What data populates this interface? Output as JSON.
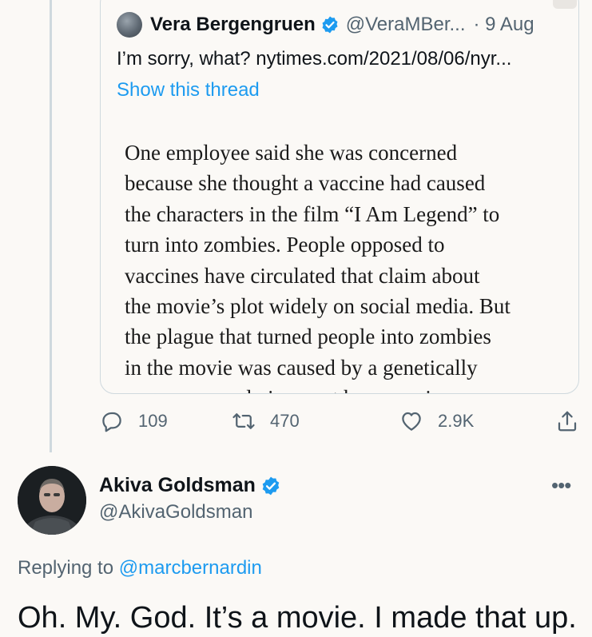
{
  "quoted_tweet": {
    "author_name": "Vera Bergengruen",
    "author_handle": "@VeraMBer...",
    "date": "· 9 Aug",
    "text": "I’m sorry, what? nytimes.com/2021/08/06/nyr...",
    "show_thread": "Show this thread",
    "article_lines": [
      "One employee said she was concerned",
      "because she thought a vaccine had caused",
      "the characters in the film “I Am Legend” to",
      "turn into zombies. People opposed to",
      "vaccines have circulated that claim about",
      "the movie’s plot widely on social media. But",
      "the plague that turned people into zombies",
      "in the movie was caused by a genetically",
      "reprogrammed virus, not by a vaccine."
    ]
  },
  "actions": {
    "reply_count": "109",
    "retweet_count": "470",
    "like_count": "2.9K"
  },
  "reply_tweet": {
    "author_name": "Akiva Goldsman",
    "author_handle": "@AkivaGoldsman",
    "replying_prefix": "Replying to",
    "replying_to": "@marcbernardin",
    "text": "Oh. My. God. It’s a movie. I made that up.",
    "more_label": "•••"
  },
  "colors": {
    "accent": "#1d9bf0",
    "muted": "#536471",
    "border": "#cfd9de",
    "background": "#fbf9f6"
  },
  "icons": {
    "verified": "verified-badge-icon",
    "reply": "reply-icon",
    "retweet": "retweet-icon",
    "like": "heart-icon",
    "share": "share-icon"
  }
}
